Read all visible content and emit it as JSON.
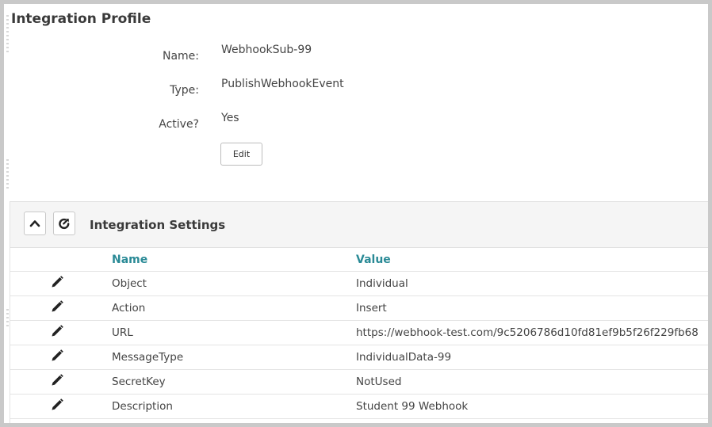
{
  "profile": {
    "title": "Integration Profile",
    "fields": [
      {
        "label": "Name:",
        "value": "WebhookSub-99"
      },
      {
        "label": "Type:",
        "value": "PublishWebhookEvent"
      },
      {
        "label": "Active?",
        "value": "Yes"
      }
    ],
    "edit_label": "Edit"
  },
  "settings": {
    "title": "Integration Settings",
    "collapse_icon": "chevron-up-icon",
    "export_icon": "share-icon",
    "columns": {
      "name": "Name",
      "value": "Value"
    },
    "row_icon": "pencil-icon",
    "rows": [
      {
        "name": "Object",
        "value": "Individual"
      },
      {
        "name": "Action",
        "value": "Insert"
      },
      {
        "name": "URL",
        "value": "https://webhook-test.com/9c5206786d10fd81ef9b5f26f229fb68"
      },
      {
        "name": "MessageType",
        "value": "IndividualData-99"
      },
      {
        "name": "SecretKey",
        "value": "NotUsed"
      },
      {
        "name": "Description",
        "value": "Student 99 Webhook"
      }
    ]
  },
  "colors": {
    "accent": "#2a8a96",
    "frame": "#c9c9c9"
  }
}
